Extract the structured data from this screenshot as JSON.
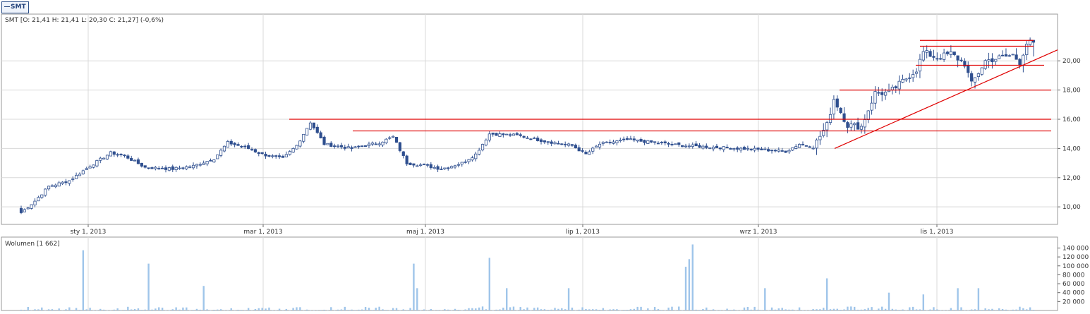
{
  "tab": {
    "symbol": "SMT"
  },
  "main_chart": {
    "info": "SMT [O: 21,41  H: 21,41  L: 20,30  C: 21,27] (-0,6%)",
    "ylim": [
      8.8,
      23.2
    ],
    "y_ticks": [
      "10,00",
      "12,00",
      "14,00",
      "16,00",
      "18,00",
      "20,00"
    ],
    "x_ticks": [
      "sty 1, 2013",
      "mar 1, 2013",
      "maj 1, 2013",
      "lip 1, 2013",
      "wrz 1, 2013",
      "lis 1, 2013"
    ]
  },
  "volume_chart": {
    "info": "Wolumen [1 662]",
    "ylim": [
      0,
      155000
    ],
    "y_ticks": [
      "20 000",
      "40 000",
      "60 000",
      "80 000",
      "100 000",
      "120 000",
      "140 000"
    ]
  },
  "colors": {
    "up": "#ffffff",
    "down": "#2f4f8f",
    "wick": "#2f4f8f",
    "line": "#e00000",
    "volume": "#9fc5ea",
    "grid": "#d8d8d8"
  },
  "chart_data": [
    {
      "type": "candlestick",
      "title": "SMT",
      "start_date": "2012-11-08",
      "x_ticks": [
        "sty 1, 2013",
        "mar 1, 2013",
        "maj 1, 2013",
        "lip 1, 2013",
        "wrz 1, 2013",
        "lis 1, 2013"
      ],
      "ylim": [
        8.8,
        23.2
      ],
      "ohlc_anchors": [
        {
          "i": 0,
          "c": 9.6
        },
        {
          "i": 4,
          "c": 10.4
        },
        {
          "i": 8,
          "c": 11.4
        },
        {
          "i": 14,
          "c": 11.8
        },
        {
          "i": 20,
          "c": 12.8
        },
        {
          "i": 26,
          "c": 13.7
        },
        {
          "i": 30,
          "c": 13.5
        },
        {
          "i": 36,
          "c": 12.7
        },
        {
          "i": 44,
          "c": 12.6
        },
        {
          "i": 50,
          "c": 12.8
        },
        {
          "i": 56,
          "c": 13.3
        },
        {
          "i": 60,
          "c": 14.4
        },
        {
          "i": 66,
          "c": 14.0
        },
        {
          "i": 70,
          "c": 13.6
        },
        {
          "i": 76,
          "c": 13.3
        },
        {
          "i": 80,
          "c": 14.2
        },
        {
          "i": 84,
          "c": 15.8
        },
        {
          "i": 88,
          "c": 14.3
        },
        {
          "i": 96,
          "c": 14.0
        },
        {
          "i": 104,
          "c": 14.4
        },
        {
          "i": 108,
          "c": 14.8
        },
        {
          "i": 112,
          "c": 13.0
        },
        {
          "i": 118,
          "c": 12.8
        },
        {
          "i": 122,
          "c": 12.6
        },
        {
          "i": 128,
          "c": 13.0
        },
        {
          "i": 132,
          "c": 13.6
        },
        {
          "i": 136,
          "c": 15.0
        },
        {
          "i": 144,
          "c": 14.9
        },
        {
          "i": 152,
          "c": 14.5
        },
        {
          "i": 160,
          "c": 14.2
        },
        {
          "i": 164,
          "c": 13.6
        },
        {
          "i": 168,
          "c": 14.3
        },
        {
          "i": 176,
          "c": 14.6
        },
        {
          "i": 184,
          "c": 14.4
        },
        {
          "i": 192,
          "c": 14.2
        },
        {
          "i": 200,
          "c": 14.1
        },
        {
          "i": 208,
          "c": 14.0
        },
        {
          "i": 216,
          "c": 13.9
        },
        {
          "i": 222,
          "c": 13.8
        },
        {
          "i": 226,
          "c": 14.3
        },
        {
          "i": 230,
          "c": 14.1
        },
        {
          "i": 234,
          "c": 15.6
        },
        {
          "i": 236,
          "c": 17.4
        },
        {
          "i": 240,
          "c": 15.6
        },
        {
          "i": 244,
          "c": 15.5
        },
        {
          "i": 248,
          "c": 17.8
        },
        {
          "i": 252,
          "c": 17.8
        },
        {
          "i": 256,
          "c": 18.6
        },
        {
          "i": 260,
          "c": 19.4
        },
        {
          "i": 262,
          "c": 20.6
        },
        {
          "i": 266,
          "c": 20.2
        },
        {
          "i": 270,
          "c": 20.5
        },
        {
          "i": 274,
          "c": 19.8
        },
        {
          "i": 276,
          "c": 18.4
        },
        {
          "i": 280,
          "c": 20.0
        },
        {
          "i": 284,
          "c": 20.2
        },
        {
          "i": 288,
          "c": 20.4
        },
        {
          "i": 290,
          "c": 19.9
        },
        {
          "i": 292,
          "c": 21.2
        },
        {
          "i": 294,
          "c": 21.27
        }
      ],
      "n_points": 295,
      "last": {
        "open": 21.41,
        "high": 21.41,
        "low": 20.3,
        "close": 21.27,
        "change": "-0,6%"
      },
      "resistance_lines": [
        16.0,
        15.2,
        18.0,
        19.7,
        21.0,
        21.4
      ],
      "trendline": [
        {
          "i": 234,
          "y": 14.0
        },
        {
          "i": 295,
          "y": 20.8
        }
      ]
    },
    {
      "type": "bar",
      "title": "Wolumen [1 662]",
      "ylim": [
        0,
        155000
      ],
      "spikes": [
        {
          "i": 18,
          "v": 135000
        },
        {
          "i": 37,
          "v": 105000
        },
        {
          "i": 53,
          "v": 55000
        },
        {
          "i": 114,
          "v": 105000
        },
        {
          "i": 115,
          "v": 50000
        },
        {
          "i": 136,
          "v": 118000
        },
        {
          "i": 141,
          "v": 50000
        },
        {
          "i": 159,
          "v": 50000
        },
        {
          "i": 193,
          "v": 98000
        },
        {
          "i": 194,
          "v": 115000
        },
        {
          "i": 195,
          "v": 148000
        },
        {
          "i": 216,
          "v": 50000
        },
        {
          "i": 234,
          "v": 72000
        },
        {
          "i": 252,
          "v": 40000
        },
        {
          "i": 262,
          "v": 36000
        },
        {
          "i": 272,
          "v": 50000
        },
        {
          "i": 278,
          "v": 50000
        }
      ]
    }
  ]
}
